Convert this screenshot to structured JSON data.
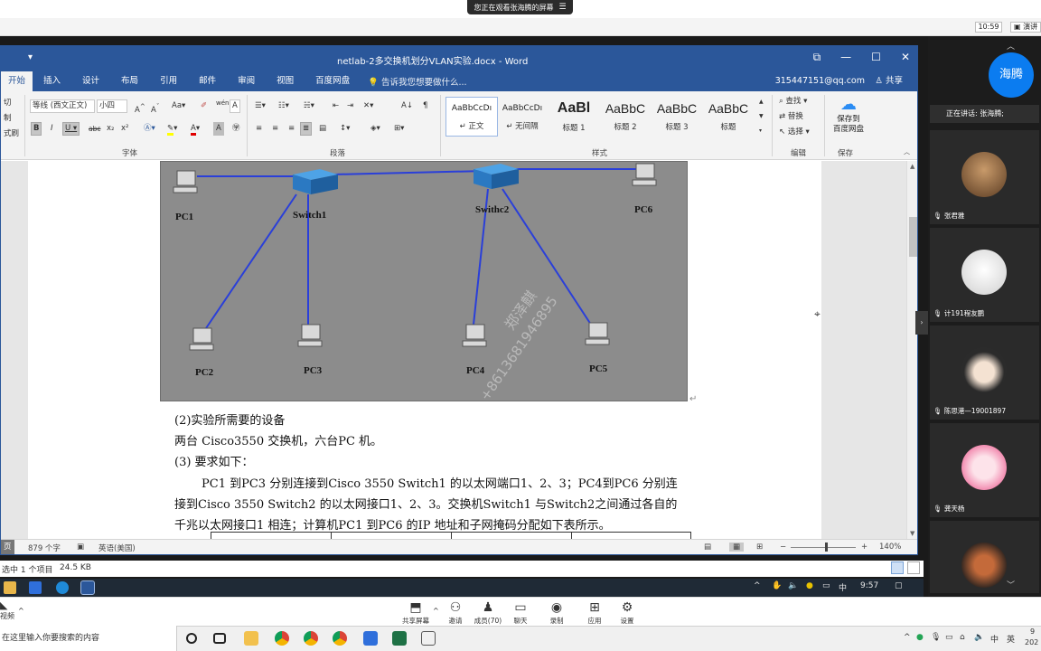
{
  "share_banner": {
    "text": "您正在观看张海腾的屏幕",
    "menu_icon": "menu-icon"
  },
  "outer_top": {
    "clock": "10:59",
    "tab_label": "演讲"
  },
  "word": {
    "title": "netlab-2多交换机划分VLAN实验.docx - Word",
    "tabs": [
      "开始",
      "插入",
      "设计",
      "布局",
      "引用",
      "邮件",
      "审阅",
      "视图",
      "百度网盘"
    ],
    "tell_me": "告诉我您想要做什么...",
    "account": "315447151@qq.com",
    "share": "共享",
    "clipboard": {
      "cut": "切",
      "copy": "制",
      "painter": "式刷"
    },
    "font": {
      "name": "等线 (西文正文)",
      "size": "小四",
      "group_label": "字体"
    },
    "paragraph": {
      "group_label": "段落"
    },
    "styles": {
      "group_label": "样式",
      "items": [
        {
          "sample": "AaBbCcDı",
          "name": "↵ 正文"
        },
        {
          "sample": "AaBbCcDı",
          "name": "↵ 无间隔"
        },
        {
          "sample": "AaBl",
          "name": "标题 1"
        },
        {
          "sample": "AaBbC",
          "name": "标题 2"
        },
        {
          "sample": "AaBbC",
          "name": "标题 3"
        },
        {
          "sample": "AaBbC",
          "name": "标题"
        }
      ]
    },
    "editing": {
      "find": "查找",
      "replace": "替换",
      "select": "选择",
      "group_label": "编辑"
    },
    "save": {
      "label": "保存到百度网盘",
      "line1": "保存到",
      "line2": "百度网盘",
      "group_label": "保存"
    },
    "diagram": {
      "labels": {
        "pc1": "PC1",
        "pc2": "PC2",
        "pc3": "PC3",
        "pc4": "PC4",
        "pc5": "PC5",
        "pc6": "PC6",
        "switch1": "Switch1",
        "switch2": "Swithc2"
      },
      "watermark": "郑泽麒",
      "watermark_number": "+8613681946895"
    },
    "doc_lines": [
      "(2)实验所需要的设备",
      "两台 Cisco3550 交换机，六台PC 机。",
      "(3) 要求如下：",
      "PC1 到PC3 分别连接到Cisco 3550 Switch1 的以太网端口1、2、3；PC4到PC6 分别连",
      "接到Cisco 3550 Switch2 的以太网接口1、2、3。交换机Switch1 与Switch2之间通过各自的",
      "千兆以太网接口1 相连；计算机PC1 到PC6 的IP 地址和子网掩码分配如下表所示。"
    ],
    "status": {
      "page": "页",
      "words": "879 个字",
      "lang": "英语(美国)",
      "zoom": "140%"
    }
  },
  "explorer": {
    "selected": "选中 1 个项目",
    "size": "24.5 KB"
  },
  "remote_taskbar": {
    "time": "9:57",
    "ime": "中"
  },
  "participants": {
    "host_avatar": "海腾",
    "speaking": "正在讲话: 张海腾;",
    "tiles": [
      {
        "name": "张君雅"
      },
      {
        "name": "计191程友鹏"
      },
      {
        "name": "陈思港—19001897"
      },
      {
        "name": "龚天杨"
      }
    ]
  },
  "meeting_toolbar": {
    "buttons": [
      {
        "label": "共享屏幕",
        "icon": "share-screen-icon"
      },
      {
        "label": "邀请",
        "icon": "invite-icon"
      },
      {
        "label": "成员(70)",
        "icon": "members-icon"
      },
      {
        "label": "聊天",
        "icon": "chat-icon"
      },
      {
        "label": "录制",
        "icon": "record-icon"
      },
      {
        "label": "应用",
        "icon": "apps-icon"
      },
      {
        "label": "设置",
        "icon": "settings-icon"
      }
    ],
    "left_label": "视频"
  },
  "local_taskbar": {
    "search_placeholder": "在这里输入你要搜索的内容",
    "ime": "中",
    "lang": "英",
    "time": "9",
    "year": "202"
  },
  "colors": {
    "word_blue": "#2b579a",
    "link_blue": "#2a3fd9",
    "host_blue": "#0b7cf0"
  }
}
